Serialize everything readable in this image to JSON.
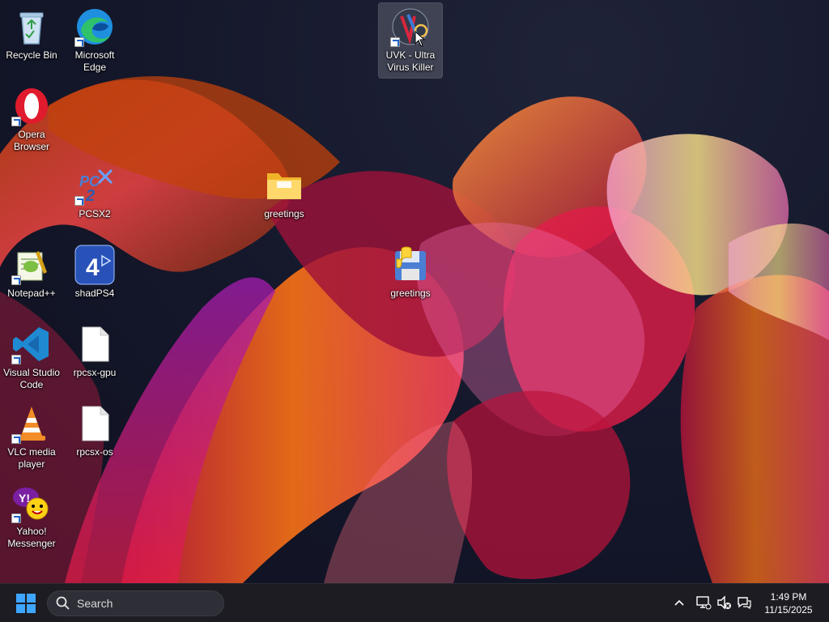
{
  "desktop": {
    "icons": [
      {
        "label": "Recycle Bin",
        "icon": "recycle-bin-icon"
      },
      {
        "label": "Microsoft Edge",
        "icon": "edge-icon"
      },
      {
        "label": "UVK - Ultra Virus Killer",
        "icon": "uvk-icon"
      },
      {
        "label": "Opera Browser",
        "icon": "opera-icon"
      },
      {
        "label": "PCSX2",
        "icon": "pcsx2-icon"
      },
      {
        "label": "greetings",
        "icon": "folder-icon"
      },
      {
        "label": "Notepad++",
        "icon": "notepadpp-icon"
      },
      {
        "label": "shadPS4",
        "icon": "shadps4-icon"
      },
      {
        "label": "greetings",
        "icon": "python-file-icon"
      },
      {
        "label": "Visual Studio Code",
        "icon": "vscode-icon"
      },
      {
        "label": "rpcsx-gpu",
        "icon": "file-icon"
      },
      {
        "label": "VLC media player",
        "icon": "vlc-icon"
      },
      {
        "label": "rpcsx-os",
        "icon": "file-icon"
      },
      {
        "label": "Yahoo! Messenger",
        "icon": "yahoo-messenger-icon"
      }
    ]
  },
  "taskbar": {
    "search_label": "Search",
    "time": "1:49 PM",
    "date": "11/15/2025"
  },
  "colors": {
    "taskbar_bg": "#1c1c22",
    "accent": "#1f8fff"
  }
}
